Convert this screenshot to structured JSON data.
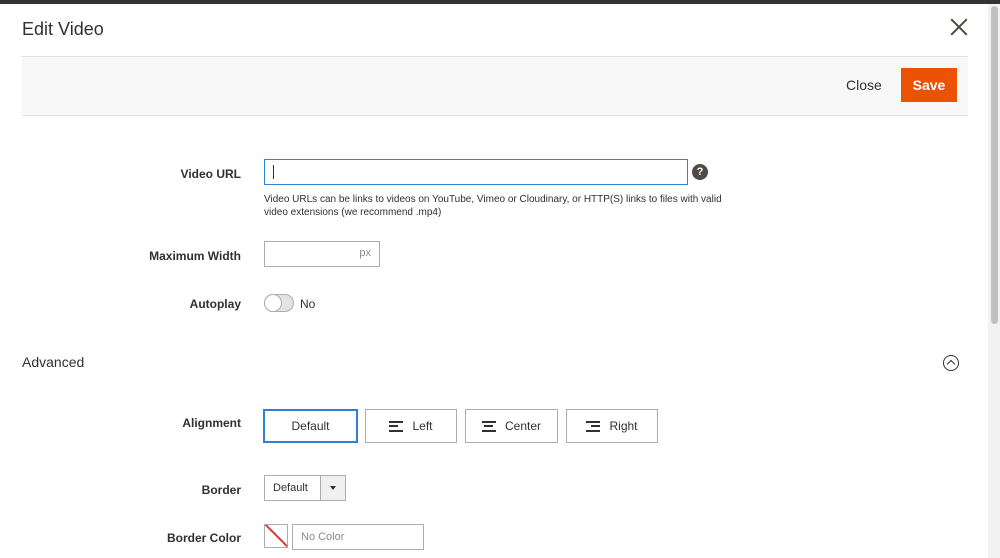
{
  "modal": {
    "title": "Edit Video",
    "close_label": "Close",
    "save_label": "Save"
  },
  "colors": {
    "primary_action": "#eb5202",
    "focus_border": "#2b82d4"
  },
  "icons": {
    "close": "close-x-icon",
    "help": "question-circle-icon",
    "collapse": "chevron-up-circle-icon"
  },
  "fields": {
    "video_url": {
      "label": "Video URL",
      "value": "",
      "help_glyph": "?",
      "note": "Video URLs can be links to videos on YouTube, Vimeo or Cloudinary, or HTTP(S) links to files with valid video extensions (we recommend .mp4)"
    },
    "max_width": {
      "label": "Maximum Width",
      "value": "",
      "unit": "px"
    },
    "autoplay": {
      "label": "Autoplay",
      "value_label": "No",
      "checked": false
    }
  },
  "advanced": {
    "title": "Advanced",
    "alignment": {
      "label": "Alignment",
      "options": [
        "Default",
        "Left",
        "Center",
        "Right"
      ],
      "selected": "Default"
    },
    "border": {
      "label": "Border",
      "selected": "Default"
    },
    "border_color": {
      "label": "Border Color",
      "placeholder": "No Color",
      "value": ""
    }
  }
}
